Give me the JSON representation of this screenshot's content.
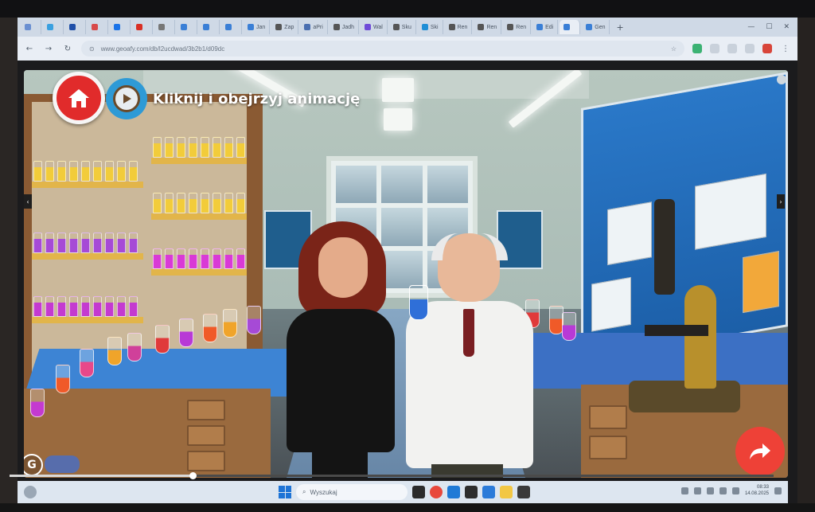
{
  "browser": {
    "tabs": [
      {
        "label": "",
        "color": "#6a8fd1"
      },
      {
        "label": "",
        "color": "#3aa0e0"
      },
      {
        "label": "",
        "color": "#1f4fa8"
      },
      {
        "label": "",
        "color": "#d84a4a"
      },
      {
        "label": "",
        "color": "#1a73e8"
      },
      {
        "label": "",
        "color": "#d93025"
      },
      {
        "label": "",
        "color": "#777777"
      },
      {
        "label": "",
        "color": "#3a7fd6"
      },
      {
        "label": "",
        "color": "#3a7fd6"
      },
      {
        "label": "",
        "color": "#3a7fd6"
      },
      {
        "label": "Jan",
        "color": "#3a7fd6"
      },
      {
        "label": "Zap",
        "color": "#555555"
      },
      {
        "label": "aPri",
        "color": "#4a6fb0"
      },
      {
        "label": "Jadh",
        "color": "#555555"
      },
      {
        "label": "Wal",
        "color": "#6f4bd8"
      },
      {
        "label": "Sku",
        "color": "#555555"
      },
      {
        "label": "Ski",
        "color": "#1f8fd6"
      },
      {
        "label": "Ren",
        "color": "#555555"
      },
      {
        "label": "Ren",
        "color": "#555555"
      },
      {
        "label": "Ren",
        "color": "#555555"
      },
      {
        "label": "Edi",
        "color": "#3a7fd6"
      },
      {
        "label": "",
        "color": "#3a7fd6",
        "active": true
      },
      {
        "label": "Gen",
        "color": "#3a7fd6"
      }
    ],
    "url": "www.geoafy.com/db/l2ucdwad/3b2b1/d09dc"
  },
  "page": {
    "caption": "Kliknij i obejrzyj animację",
    "home_icon": "home-icon",
    "play_icon": "play-icon",
    "next_icon": "share-arrow-icon",
    "brand_letter": "G",
    "progress": 0.24,
    "accent_red": "#e12b2b",
    "accent_blue": "#2e9ad6"
  },
  "taskbar": {
    "search_placeholder": "Wyszukaj",
    "time": "08:33",
    "date": "14.08.2025"
  }
}
